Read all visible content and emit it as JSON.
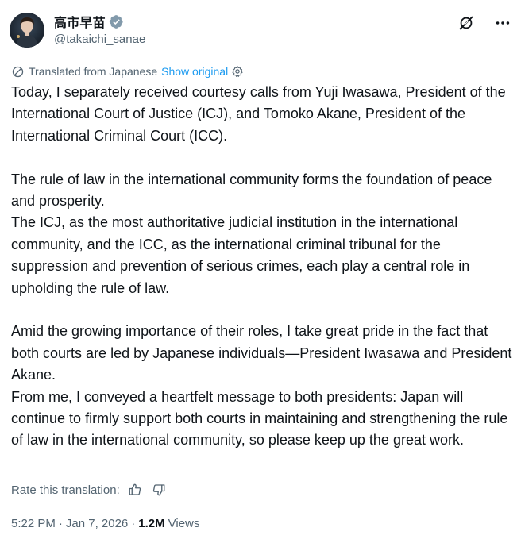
{
  "author": {
    "display_name": "高市早苗",
    "handle": "@takaichi_sanae",
    "verified": true
  },
  "translation": {
    "label": "Translated from Japanese",
    "show_original": "Show original"
  },
  "tweet": {
    "paragraphs": [
      "Today, I separately received courtesy calls from Yuji Iwasawa, President of the International Court of Justice (ICJ), and Tomoko Akane, President of the International Criminal Court (ICC).",
      "",
      "The rule of law in the international community forms the foundation of peace and prosperity.",
      "The ICJ, as the most authoritative judicial institution in the international community, and the ICC, as the international criminal tribunal for the suppression and prevention of serious crimes, each play a central role in upholding the rule of law.",
      "",
      "Amid the growing importance of their roles, I take great pride in the fact that both courts are led by Japanese individuals—President Iwasawa and President Akane.",
      "From me, I conveyed a heartfelt message to both presidents: Japan will continue to firmly support both courts in maintaining and strengthening the rule of law in the international community, so please keep up the great work."
    ]
  },
  "rate": {
    "label": "Rate this translation:"
  },
  "meta": {
    "time": "5:22 PM",
    "date": "Jan 7, 2026",
    "views_count": "1.2M",
    "views_label": "Views",
    "separator": "·"
  },
  "icons": {
    "verified": "verified-badge-icon",
    "grok": "grok-icon",
    "more": "more-horizontal-icon",
    "translate": "translate-icon",
    "settings": "gear-icon",
    "thumbs_up": "thumbs-up-icon",
    "thumbs_down": "thumbs-down-icon"
  },
  "colors": {
    "accent": "#1d9bf0",
    "secondary_text": "#536471",
    "primary_text": "#0f1419"
  }
}
